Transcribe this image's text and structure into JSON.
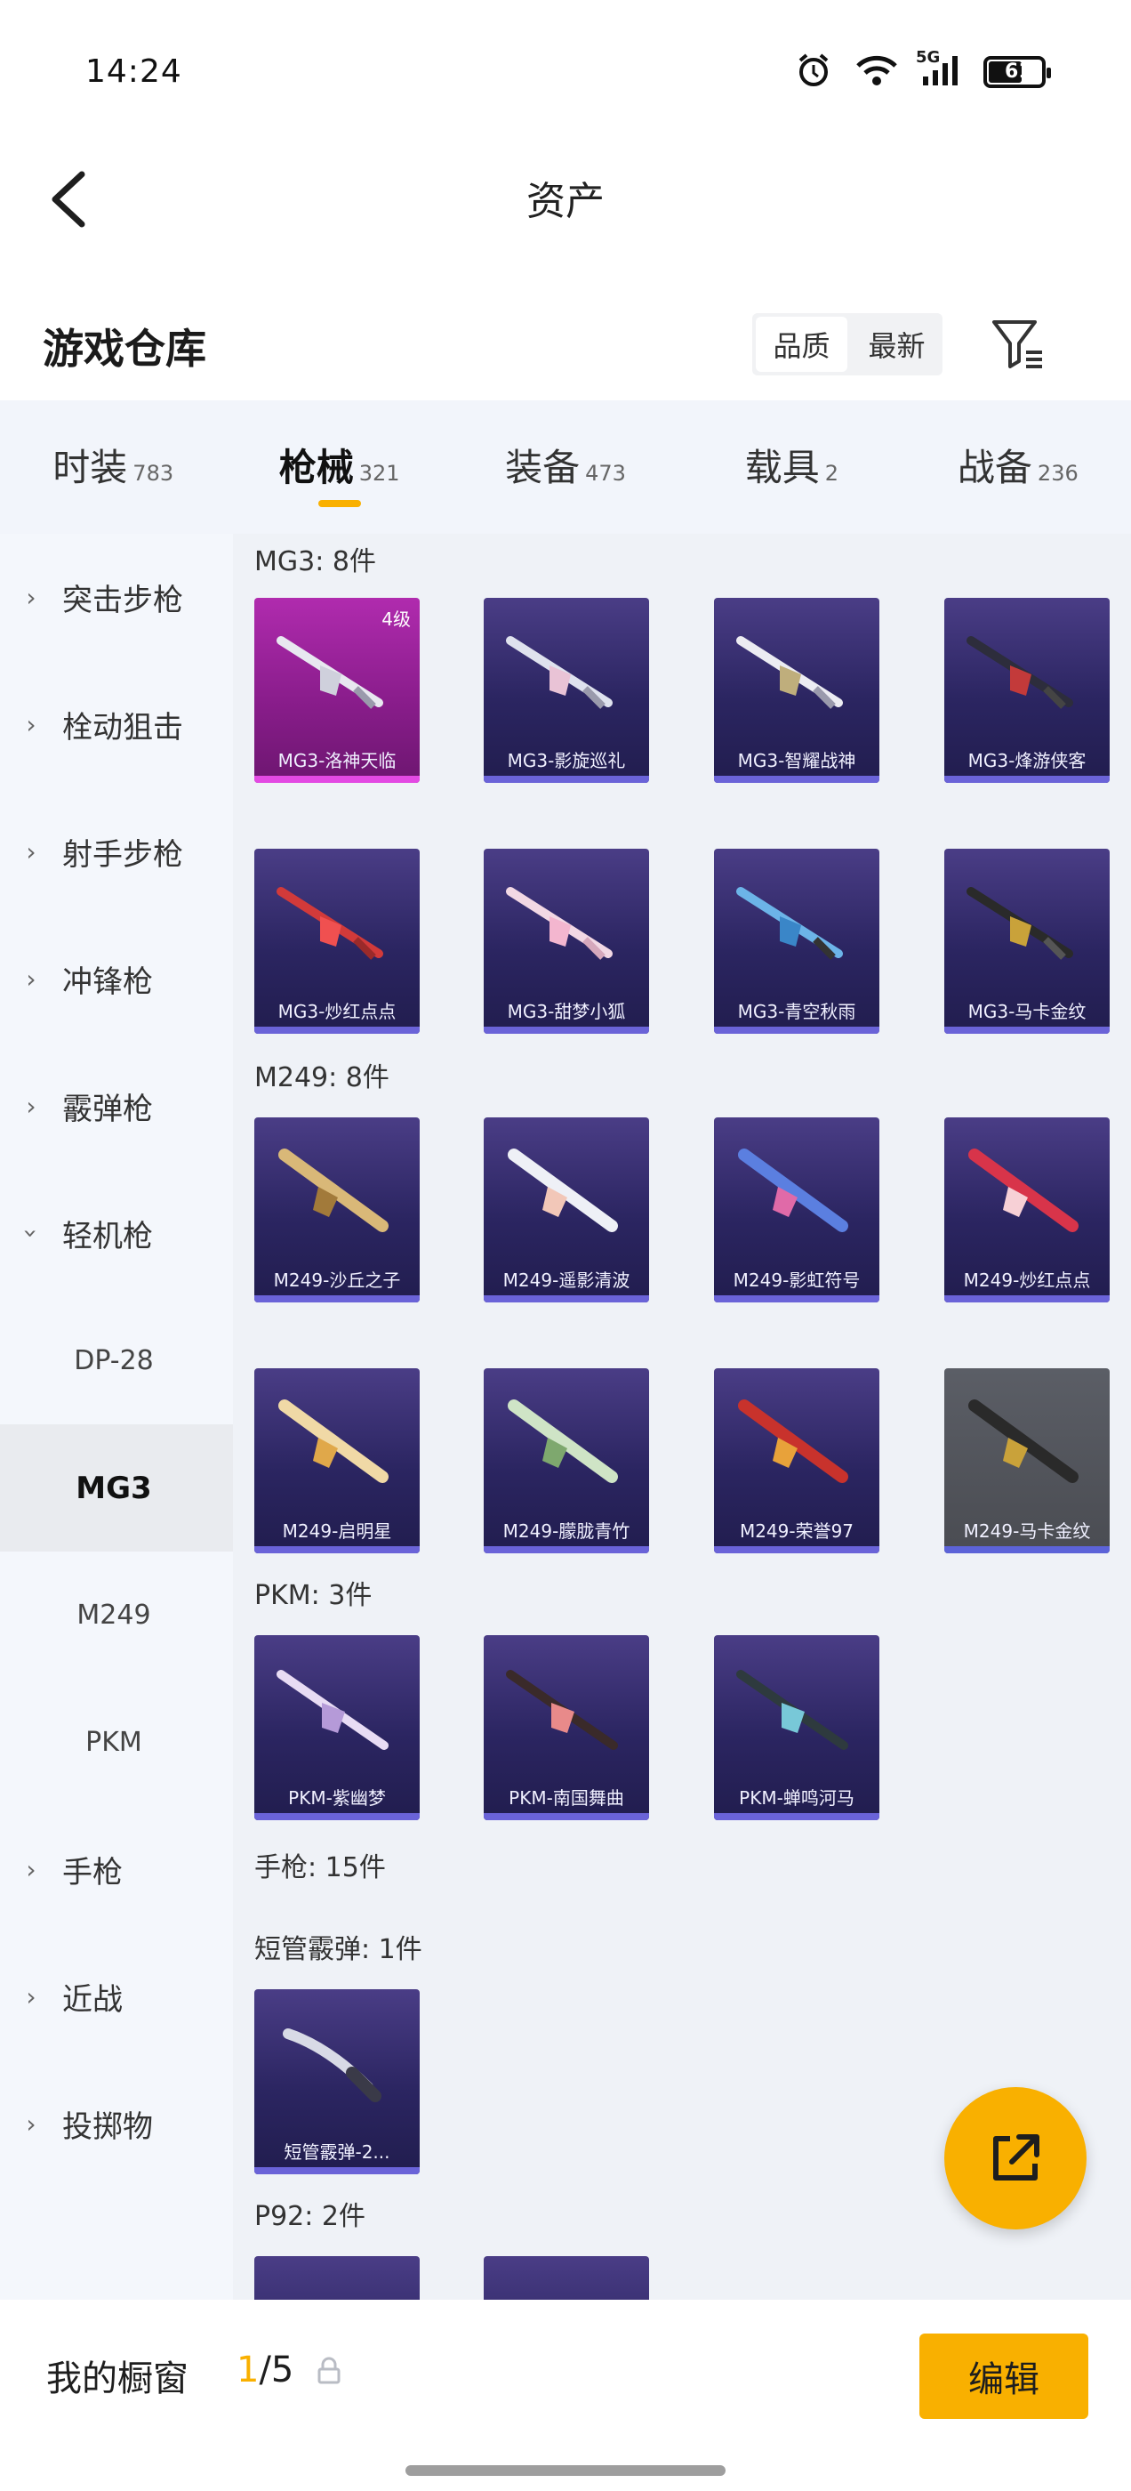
{
  "status_bar": {
    "time": "14:24",
    "network": "5G",
    "battery": "61"
  },
  "nav": {
    "title": "资产"
  },
  "warehouse": {
    "title": "游戏仓库",
    "sort_options": [
      "品质",
      "最新"
    ],
    "active_sort": "品质"
  },
  "tabs": [
    {
      "label": "时装",
      "count": "783"
    },
    {
      "label": "枪械",
      "count": "321",
      "active": true
    },
    {
      "label": "装备",
      "count": "473"
    },
    {
      "label": "载具",
      "count": "2"
    },
    {
      "label": "战备",
      "count": "236"
    }
  ],
  "sidebar": {
    "items": [
      {
        "label": "突击步枪",
        "collapsed": true
      },
      {
        "label": "栓动狙击",
        "collapsed": true
      },
      {
        "label": "射手步枪",
        "collapsed": true
      },
      {
        "label": "冲锋枪",
        "collapsed": true
      },
      {
        "label": "霰弹枪",
        "collapsed": true
      },
      {
        "label": "轻机枪",
        "collapsed": false
      },
      {
        "label": "DP-28",
        "sub": true
      },
      {
        "label": "MG3",
        "sub": true,
        "active": true
      },
      {
        "label": "M249",
        "sub": true
      },
      {
        "label": "PKM",
        "sub": true
      },
      {
        "label": "手枪",
        "collapsed": true
      },
      {
        "label": "近战",
        "collapsed": true
      },
      {
        "label": "投掷物",
        "collapsed": true
      }
    ]
  },
  "sections": [
    {
      "title": "MG3: 8件",
      "items": [
        {
          "name": "MG3-洛神天临",
          "grade": "4级",
          "tier": "gold"
        },
        {
          "name": "MG3-影旋巡礼",
          "tier": "purple"
        },
        {
          "name": "MG3-智耀战神",
          "tier": "purple"
        },
        {
          "name": "MG3-烽游侠客",
          "tier": "purple"
        },
        {
          "name": "MG3-炒红点点",
          "tier": "purple"
        },
        {
          "name": "MG3-甜梦小狐",
          "tier": "purple"
        },
        {
          "name": "MG3-青空秋雨",
          "tier": "purple"
        },
        {
          "name": "MG3-马卡金纹",
          "tier": "purple"
        }
      ]
    },
    {
      "title": "M249: 8件",
      "items": [
        {
          "name": "M249-沙丘之子",
          "tier": "purple"
        },
        {
          "name": "M249-遥影清波",
          "tier": "purple"
        },
        {
          "name": "M249-影虹符号",
          "tier": "purple"
        },
        {
          "name": "M249-炒红点点",
          "tier": "purple"
        },
        {
          "name": "M249-启明星",
          "tier": "purple"
        },
        {
          "name": "M249-朦胧青竹",
          "tier": "purple"
        },
        {
          "name": "M249-荣誉97",
          "tier": "purple"
        },
        {
          "name": "M249-马卡金纹",
          "tier": "gray"
        }
      ]
    },
    {
      "title": "PKM: 3件",
      "items": [
        {
          "name": "PKM-紫幽梦",
          "tier": "purple"
        },
        {
          "name": "PKM-南国舞曲",
          "tier": "purple"
        },
        {
          "name": "PKM-蝉鸣河马",
          "tier": "purple"
        }
      ]
    },
    {
      "title": "手枪: 15件",
      "items": []
    },
    {
      "title": "短管霰弹: 1件",
      "items": [
        {
          "name": "短管霰弹-2...",
          "tier": "purple"
        }
      ]
    },
    {
      "title": "P92: 2件",
      "items": [
        {
          "name": "",
          "tier": "purple"
        },
        {
          "name": "",
          "tier": "purple"
        }
      ]
    }
  ],
  "showcase": {
    "label": "我的橱窗",
    "current": "1",
    "total": "/5"
  },
  "edit_button": "编辑",
  "colors": {
    "accent": "#f9b000",
    "purple_card": "#2b2561",
    "gold_card": "#b02bae",
    "gray_card": "#4a4c52"
  },
  "icons": {
    "back": "chevron-left-icon",
    "filter": "filter-icon",
    "share": "share-icon",
    "lock": "lock-icon",
    "alarm": "alarm-icon",
    "wifi": "wifi-icon",
    "signal": "signal-icon",
    "battery": "battery-icon"
  }
}
